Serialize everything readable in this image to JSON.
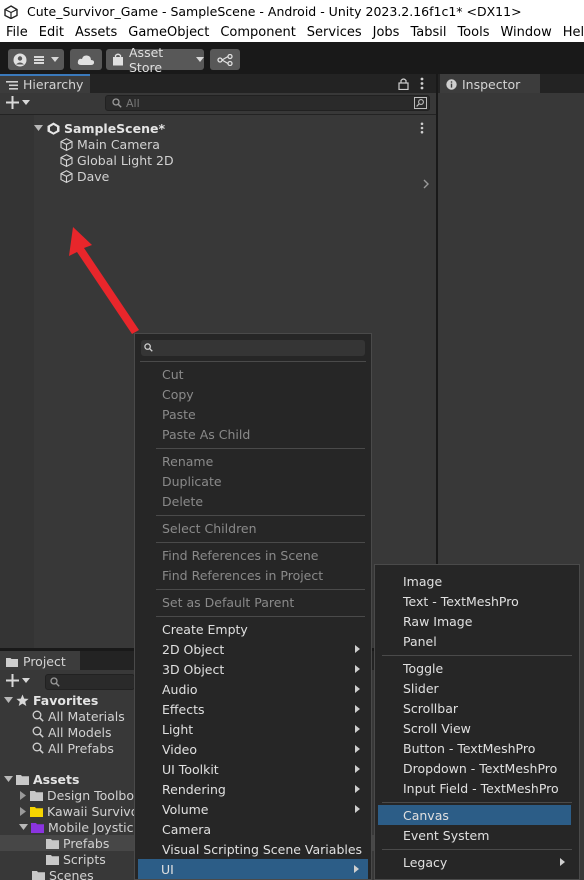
{
  "window": {
    "title": "Cute_Survivor_Game - SampleScene - Android - Unity 2023.2.16f1c1* <DX11>"
  },
  "menubar": [
    "File",
    "Edit",
    "Assets",
    "GameObject",
    "Component",
    "Services",
    "Jobs",
    "Tabsil",
    "Tools",
    "Window",
    "Help"
  ],
  "toolbar": {
    "asset_store": "Asset Store"
  },
  "hierarchy": {
    "tab": "Hierarchy",
    "search_placeholder": "All",
    "scene": "SampleScene*",
    "objects": [
      "Main Camera",
      "Global Light 2D",
      "Dave"
    ]
  },
  "inspector": {
    "tab": "Inspector"
  },
  "project": {
    "tab": "Project",
    "favorites": {
      "label": "Favorites",
      "items": [
        "All Materials",
        "All Models",
        "All Prefabs"
      ]
    },
    "assets": {
      "label": "Assets",
      "folders": [
        "Design Toolbox",
        "Kawaii Survivor",
        "Mobile Joystick"
      ],
      "subfolders": [
        "Prefabs",
        "Scripts"
      ],
      "last": "Scenes"
    }
  },
  "context_menu": {
    "groups": [
      [
        "Cut",
        "Copy",
        "Paste",
        "Paste As Child"
      ],
      [
        "Rename",
        "Duplicate",
        "Delete"
      ],
      [
        "Select Children"
      ],
      [
        "Find References in Scene",
        "Find References in Project"
      ],
      [
        "Set as Default Parent"
      ]
    ],
    "items": [
      "Create Empty",
      "2D Object",
      "3D Object",
      "Audio",
      "Effects",
      "Light",
      "Video",
      "UI Toolkit",
      "Rendering",
      "Volume",
      "Camera",
      "Visual Scripting Scene Variables",
      "UI"
    ],
    "submenu_items": [
      "2D Object",
      "3D Object",
      "Audio",
      "Effects",
      "Light",
      "Video",
      "UI Toolkit",
      "Rendering",
      "Volume",
      "UI"
    ],
    "highlighted": "UI"
  },
  "ui_submenu": {
    "groups": [
      [
        "Image",
        "Text - TextMeshPro",
        "Raw Image",
        "Panel"
      ],
      [
        "Toggle",
        "Slider",
        "Scrollbar",
        "Scroll View",
        "Button - TextMeshPro",
        "Dropdown - TextMeshPro",
        "Input Field - TextMeshPro"
      ],
      [
        "Canvas",
        "Event System"
      ],
      [
        "Legacy"
      ]
    ],
    "highlighted": "Canvas"
  },
  "colors": {
    "panel": "#383838",
    "menu_bg": "#262626",
    "selection": "#2c5d87",
    "arrow": "#e8262b",
    "favorites_star": "#d8d8d8",
    "folder_yellow": "#f5d400",
    "folder_purple": "#8b34e0"
  }
}
